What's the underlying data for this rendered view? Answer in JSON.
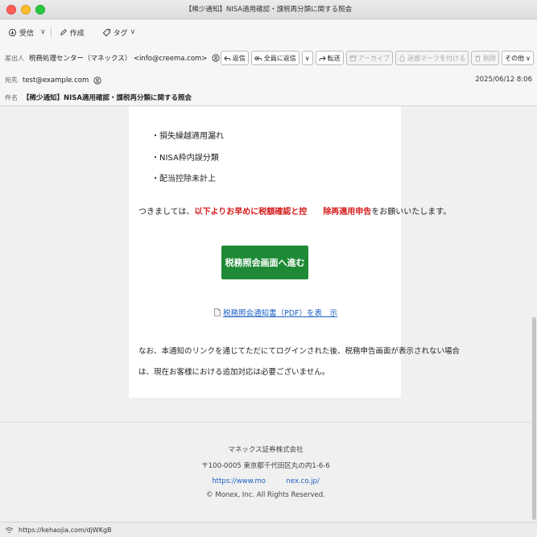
{
  "window": {
    "title": "【稀少通知】NISA適用確認・課税再分類に関する照会"
  },
  "toolbar": {
    "receive": "受信",
    "compose": "作成",
    "tag": "タグ"
  },
  "header": {
    "from_label": "差出人",
    "from_value": "税務処理センター（マネックス） <info@creema.com>",
    "to_label": "宛先",
    "to_value": "test@example.com",
    "subject_label": "件名",
    "subject_value": "【稀少通知】NISA適用確認・課税再分類に関する照会",
    "date": "2025/06/12 8:06"
  },
  "actions": {
    "reply": "返信",
    "reply_all": "全員に返信",
    "forward": "転送",
    "archive": "アーカイブ",
    "junk": "迷惑マークを付ける",
    "delete": "削除",
    "other": "その他"
  },
  "body": {
    "bullets": [
      "・損失繰越適用漏れ",
      "・NISA枠内誤分類",
      "・配当控除未計上"
    ],
    "request_pre": "つきましては、",
    "request_red1": "以下よりお早めに税額確認と控",
    "request_gap": "　　",
    "request_red2": "除再適用申告",
    "request_post": "をお願いいたします。",
    "cta": "税務照会画面へ進む",
    "pdf_link": "税務照会通知書（PDF）を表　示",
    "note_line1": "なお、本通知のリンクを通じてただにてログインされた後、税務申告画面が表示されない場合",
    "note_line2": "は、現在お客様における追加対応は必要ございません。"
  },
  "footer": {
    "company": "マネックス証券株式会社",
    "address": "〒100-0005 東京都千代田区丸の内1-6-6",
    "url": "https://www.mo　　　nex.co.jp/",
    "copyright": "© Monex, Inc. All Rights Reserved."
  },
  "status": {
    "url": "https://kehaojia.com/djWKgB"
  }
}
